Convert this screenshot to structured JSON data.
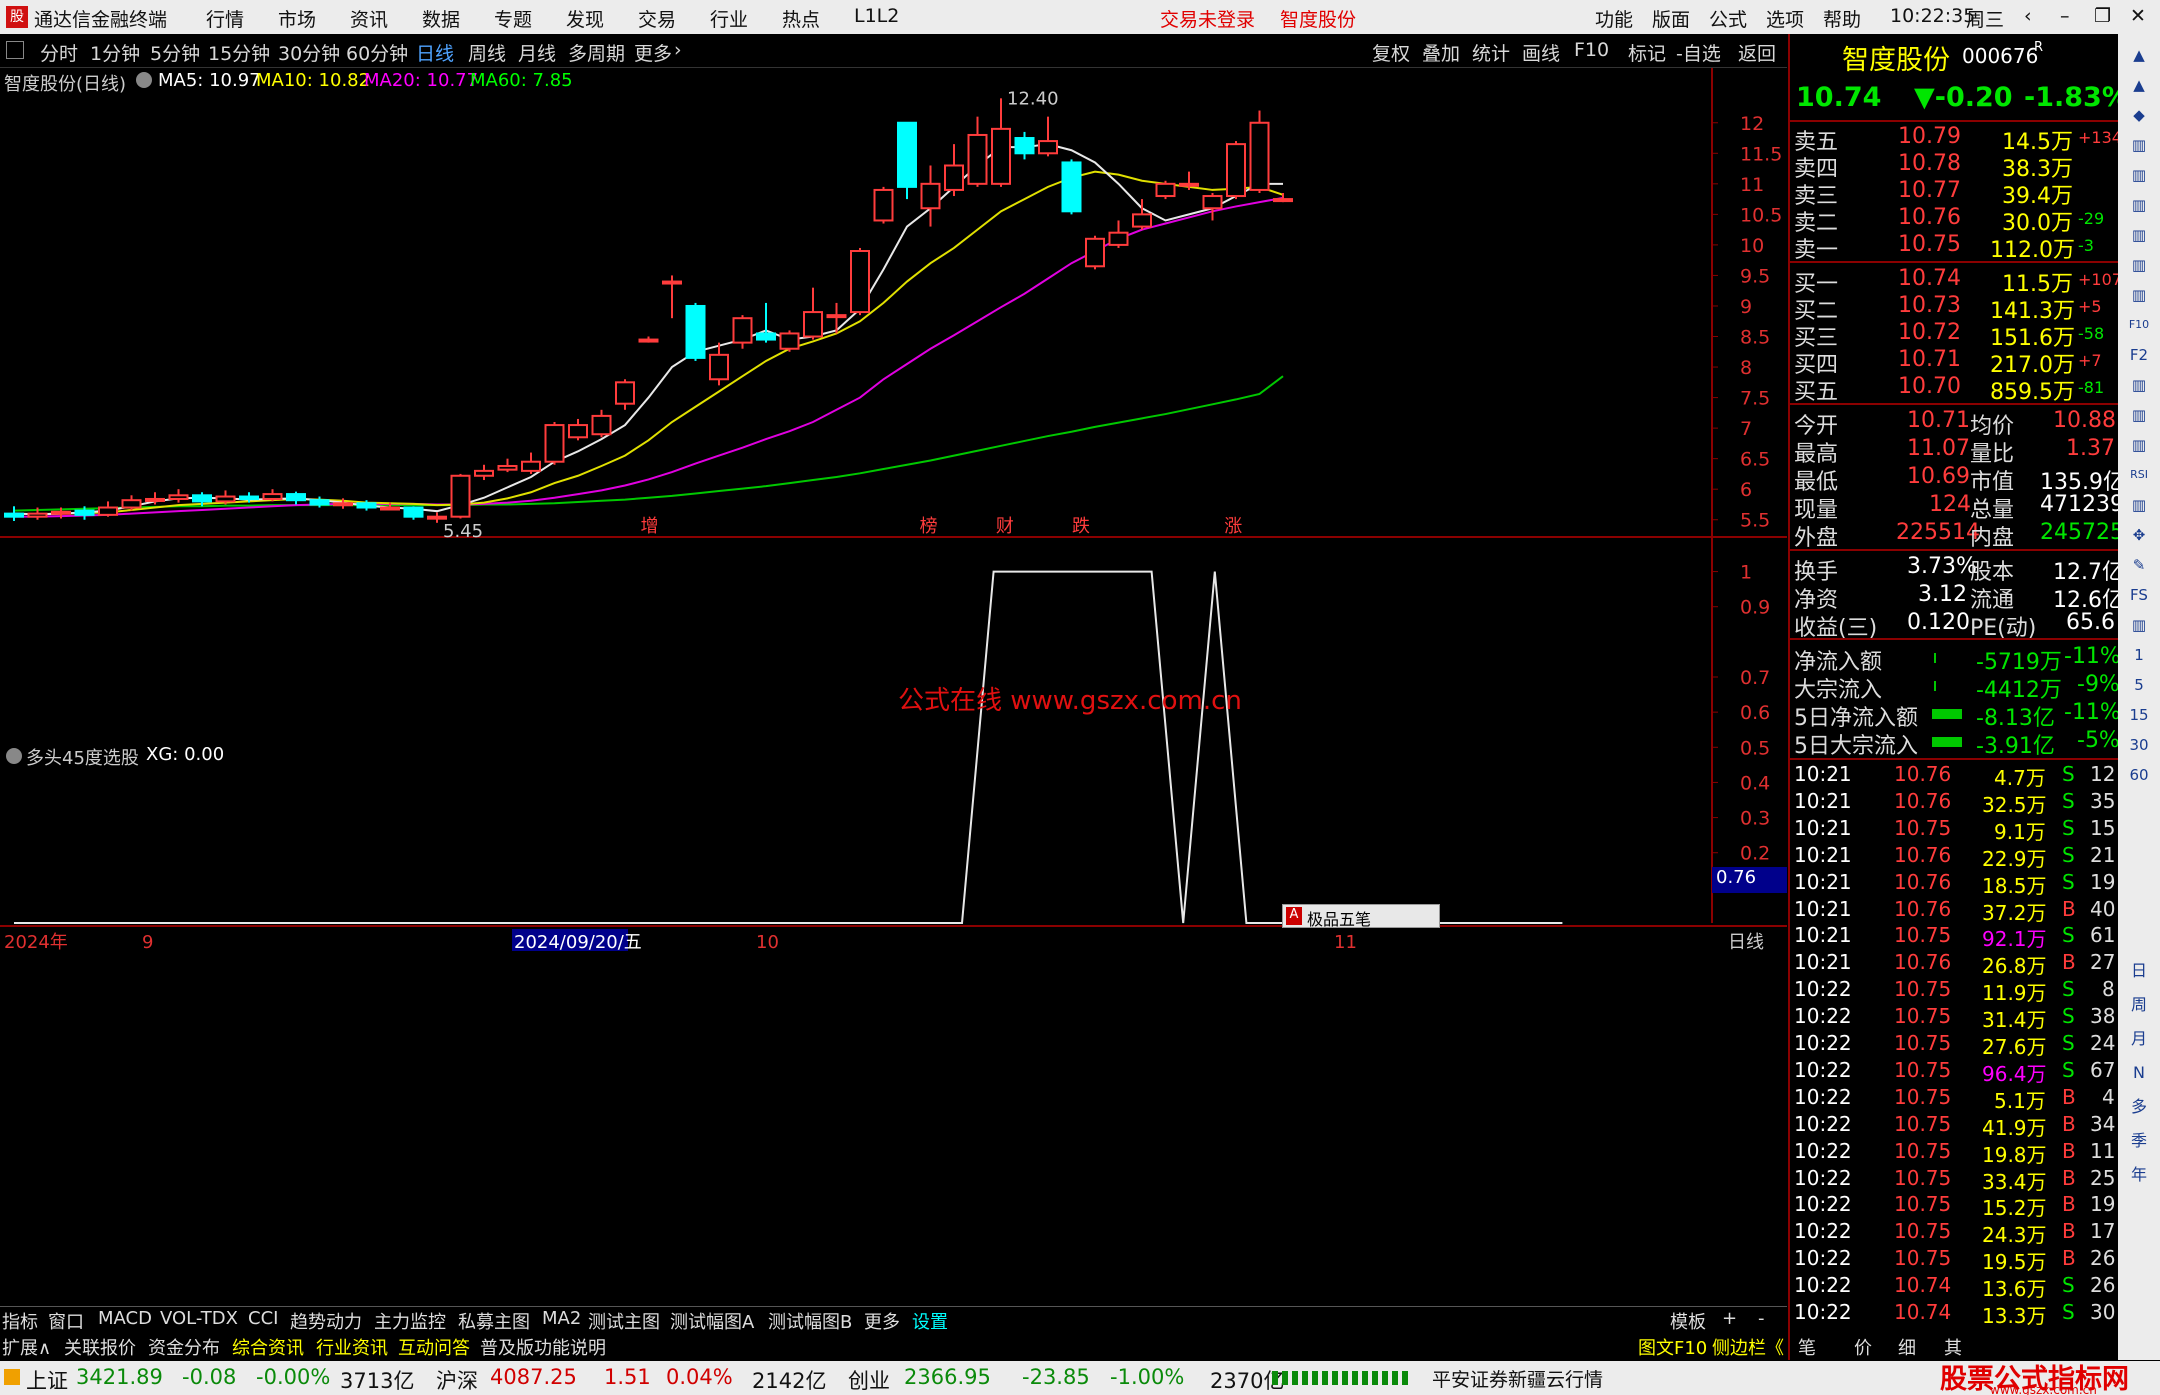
{
  "app": {
    "name": "通达信金融终端",
    "menus": [
      "行情",
      "市场",
      "资讯",
      "数据",
      "专题",
      "发现",
      "交易",
      "行业",
      "热点",
      "L1L2"
    ],
    "login_status": "交易未登录",
    "stock_title": "智度股份",
    "right_menus": [
      "功能",
      "版面",
      "公式",
      "选项",
      "帮助"
    ],
    "time": "10:22:35",
    "weekday": "周三"
  },
  "toolbar": {
    "periods": [
      "分时",
      "1分钟",
      "5分钟",
      "15分钟",
      "30分钟",
      "60分钟",
      "日线",
      "周线",
      "月线",
      "多周期",
      "更多"
    ],
    "active": "日线",
    "right_buttons": [
      "复权",
      "叠加",
      "统计",
      "画线",
      "F10",
      "标记",
      "-自选",
      "返回"
    ]
  },
  "main_chart": {
    "label": "智度股份(日线)",
    "ma": [
      {
        "label": "MA5: 10.97",
        "color": "#ffffff"
      },
      {
        "label": "MA10: 10.82",
        "color": "#ffff00"
      },
      {
        "label": "MA20: 10.77",
        "color": "#ff00ff"
      },
      {
        "label": "MA60: 7.85",
        "color": "#00ff00"
      }
    ],
    "high_label": "12.40",
    "low_label": "5.45",
    "watermark": "公式在线 www.gszx.com.cn",
    "events": [
      "增",
      "榜",
      "财",
      "跌",
      "涨"
    ]
  },
  "chart_data": [
    {
      "type": "candlestick",
      "yticks": [
        12.0,
        11.5,
        11.0,
        10.5,
        10.0,
        9.5,
        9.0,
        8.5,
        8.0,
        7.5,
        7.0,
        6.5,
        6.0,
        5.5
      ],
      "ylim": [
        5.25,
        12.7
      ],
      "candles": [
        [
          5.6,
          5.55,
          5.72,
          5.48
        ],
        [
          5.55,
          5.6,
          5.7,
          5.5
        ],
        [
          5.6,
          5.63,
          5.7,
          5.52
        ],
        [
          5.65,
          5.58,
          5.72,
          5.5
        ],
        [
          5.58,
          5.7,
          5.8,
          5.55
        ],
        [
          5.7,
          5.82,
          5.9,
          5.65
        ],
        [
          5.82,
          5.84,
          5.95,
          5.75
        ],
        [
          5.84,
          5.9,
          6.0,
          5.78
        ],
        [
          5.9,
          5.8,
          5.95,
          5.72
        ],
        [
          5.8,
          5.88,
          5.98,
          5.75
        ],
        [
          5.88,
          5.84,
          5.95,
          5.78
        ],
        [
          5.84,
          5.92,
          6.0,
          5.8
        ],
        [
          5.92,
          5.82,
          5.96,
          5.75
        ],
        [
          5.82,
          5.75,
          5.88,
          5.7
        ],
        [
          5.75,
          5.77,
          5.85,
          5.68
        ],
        [
          5.77,
          5.7,
          5.82,
          5.65
        ],
        [
          5.7,
          5.7,
          5.78,
          5.66
        ],
        [
          5.7,
          5.55,
          5.72,
          5.5
        ],
        [
          5.55,
          5.55,
          5.62,
          5.45
        ],
        [
          5.55,
          6.22,
          6.25,
          5.52
        ],
        [
          6.22,
          6.3,
          6.4,
          6.15
        ],
        [
          6.32,
          6.38,
          6.5,
          6.28
        ],
        [
          6.3,
          6.45,
          6.6,
          6.25
        ],
        [
          6.45,
          7.05,
          7.1,
          6.4
        ],
        [
          6.85,
          7.05,
          7.15,
          6.8
        ],
        [
          6.9,
          7.2,
          7.3,
          6.85
        ],
        [
          7.4,
          7.75,
          7.8,
          7.3
        ],
        [
          8.45,
          8.45,
          8.5,
          8.4
        ],
        [
          9.4,
          9.4,
          9.5,
          8.8
        ],
        [
          9.0,
          8.15,
          9.05,
          8.1
        ],
        [
          7.8,
          8.2,
          8.4,
          7.7
        ],
        [
          8.4,
          8.8,
          8.85,
          8.3
        ],
        [
          8.55,
          8.45,
          9.05,
          8.4
        ],
        [
          8.3,
          8.55,
          8.6,
          8.25
        ],
        [
          8.5,
          8.9,
          9.3,
          8.45
        ],
        [
          8.85,
          8.85,
          9.05,
          8.55
        ],
        [
          8.9,
          9.9,
          9.95,
          8.85
        ],
        [
          10.4,
          10.9,
          10.95,
          10.35
        ],
        [
          12.0,
          10.95,
          12.0,
          10.75
        ],
        [
          10.6,
          11.0,
          11.3,
          10.3
        ],
        [
          10.9,
          11.3,
          11.65,
          10.8
        ],
        [
          11.0,
          11.8,
          12.1,
          10.95
        ],
        [
          11.0,
          11.9,
          12.4,
          10.95
        ],
        [
          11.75,
          11.5,
          11.85,
          11.4
        ],
        [
          11.5,
          11.7,
          12.1,
          11.45
        ],
        [
          11.35,
          10.55,
          11.4,
          10.5
        ],
        [
          9.65,
          10.1,
          10.15,
          9.6
        ],
        [
          10.0,
          10.2,
          10.4,
          9.95
        ],
        [
          10.3,
          10.5,
          10.75,
          10.25
        ],
        [
          10.8,
          11.0,
          11.05,
          10.75
        ],
        [
          11.0,
          11.0,
          11.2,
          10.9
        ],
        [
          10.6,
          10.8,
          10.85,
          10.4
        ],
        [
          10.8,
          11.65,
          11.7,
          10.75
        ],
        [
          10.9,
          12.0,
          12.2,
          10.85
        ],
        [
          10.75,
          10.75,
          10.85,
          10.7
        ]
      ],
      "ma5": [
        5.6,
        5.59,
        5.6,
        5.62,
        5.65,
        5.72,
        5.8,
        5.85,
        5.86,
        5.85,
        5.83,
        5.84,
        5.85,
        5.82,
        5.78,
        5.73,
        5.7,
        5.68,
        5.64,
        5.74,
        5.86,
        6.03,
        6.2,
        6.45,
        6.62,
        6.82,
        7.05,
        7.5,
        8.0,
        8.25,
        8.35,
        8.45,
        8.6,
        8.45,
        8.5,
        8.6,
        8.95,
        9.6,
        10.3,
        10.6,
        10.95,
        11.3,
        11.6,
        11.6,
        11.65,
        11.55,
        11.35,
        11.0,
        10.6,
        10.4,
        10.5,
        10.6,
        10.8,
        11.0,
        11.0
      ],
      "ma10": [
        5.6,
        5.59,
        5.6,
        5.61,
        5.62,
        5.66,
        5.7,
        5.74,
        5.76,
        5.78,
        5.8,
        5.82,
        5.84,
        5.83,
        5.81,
        5.78,
        5.77,
        5.76,
        5.74,
        5.75,
        5.78,
        5.85,
        5.95,
        6.1,
        6.22,
        6.38,
        6.55,
        6.8,
        7.1,
        7.35,
        7.6,
        7.85,
        8.1,
        8.3,
        8.42,
        8.55,
        8.75,
        9.05,
        9.4,
        9.7,
        9.95,
        10.25,
        10.55,
        10.75,
        10.95,
        11.1,
        11.2,
        11.15,
        11.05,
        11.0,
        10.95,
        10.9,
        10.92,
        10.95,
        10.82
      ],
      "ma20": [
        5.55,
        5.55,
        5.56,
        5.57,
        5.58,
        5.6,
        5.62,
        5.64,
        5.66,
        5.68,
        5.7,
        5.72,
        5.74,
        5.75,
        5.76,
        5.76,
        5.76,
        5.76,
        5.75,
        5.75,
        5.76,
        5.78,
        5.81,
        5.86,
        5.92,
        5.98,
        6.06,
        6.16,
        6.28,
        6.42,
        6.55,
        6.68,
        6.82,
        6.95,
        7.1,
        7.3,
        7.5,
        7.8,
        8.05,
        8.3,
        8.52,
        8.75,
        8.98,
        9.2,
        9.45,
        9.7,
        9.9,
        10.1,
        10.25,
        10.35,
        10.45,
        10.55,
        10.63,
        10.7,
        10.77
      ],
      "ma60": [
        5.65,
        5.66,
        5.67,
        5.68,
        5.69,
        5.7,
        5.71,
        5.72,
        5.72,
        5.73,
        5.73,
        5.74,
        5.74,
        5.74,
        5.74,
        5.74,
        5.74,
        5.74,
        5.74,
        5.74,
        5.75,
        5.75,
        5.76,
        5.77,
        5.79,
        5.81,
        5.83,
        5.86,
        5.89,
        5.93,
        5.97,
        6.01,
        6.05,
        6.1,
        6.15,
        6.2,
        6.26,
        6.33,
        6.4,
        6.47,
        6.55,
        6.63,
        6.71,
        6.79,
        6.87,
        6.94,
        7.02,
        7.09,
        7.16,
        7.23,
        7.31,
        7.39,
        7.47,
        7.56,
        7.85
      ]
    },
    {
      "type": "line",
      "label": "多头45度选股",
      "value_label": "XG: 0.00",
      "yticks": [
        1.0,
        0.9,
        0.7,
        0.6,
        0.5,
        0.4,
        0.3,
        0.2
      ],
      "ylim": [
        0,
        1.05
      ],
      "values": [
        0,
        0,
        0,
        0,
        0,
        0,
        0,
        0,
        0,
        0,
        0,
        0,
        0,
        0,
        0,
        0,
        0,
        0,
        0,
        0,
        0,
        0,
        0,
        0,
        0,
        0,
        0,
        0,
        0,
        0,
        0,
        1,
        1,
        1,
        1,
        1,
        1,
        0,
        1,
        0,
        0,
        0,
        0,
        0,
        0,
        0,
        0,
        0,
        0,
        0
      ],
      "cursor_label": "0.76"
    }
  ],
  "x_axis": [
    "2024年",
    "9",
    "2024/09/20/五",
    "10",
    "11"
  ],
  "x_axis_right": "日线",
  "ime_label": "极品五笔",
  "quote": {
    "name": "智度股份",
    "code": "000676",
    "flag": "R",
    "price": "10.74",
    "change": "▼-0.20",
    "pct": "-1.83%",
    "asks": [
      {
        "label": "卖五",
        "price": "10.79",
        "vol": "14.5万",
        "chg": "+134"
      },
      {
        "label": "卖四",
        "price": "10.78",
        "vol": "38.3万",
        "chg": ""
      },
      {
        "label": "卖三",
        "price": "10.77",
        "vol": "39.4万",
        "chg": ""
      },
      {
        "label": "卖二",
        "price": "10.76",
        "vol": "30.0万",
        "chg": "-29"
      },
      {
        "label": "卖一",
        "price": "10.75",
        "vol": "112.0万",
        "chg": "-3"
      }
    ],
    "bids": [
      {
        "label": "买一",
        "price": "10.74",
        "vol": "11.5万",
        "chg": "+107"
      },
      {
        "label": "买二",
        "price": "10.73",
        "vol": "141.3万",
        "chg": "+5"
      },
      {
        "label": "买三",
        "price": "10.72",
        "vol": "151.6万",
        "chg": "-58"
      },
      {
        "label": "买四",
        "price": "10.71",
        "vol": "217.0万",
        "chg": "+7"
      },
      {
        "label": "买五",
        "price": "10.70",
        "vol": "859.5万",
        "chg": "-81"
      }
    ],
    "stats": [
      [
        "今开",
        "10.71",
        "均价",
        "10.88"
      ],
      [
        "最高",
        "11.07",
        "量比",
        "1.37"
      ],
      [
        "最低",
        "10.69",
        "市值",
        "135.9亿"
      ],
      [
        "现量",
        "124",
        "总量",
        "471239"
      ],
      [
        "外盘",
        "225514",
        "内盘",
        "245725"
      ],
      [
        "换手",
        "3.73%",
        "股本",
        "12.7亿"
      ],
      [
        "净资",
        "3.12",
        "流通",
        "12.6亿"
      ],
      [
        "收益(三)",
        "0.120",
        "PE(动)",
        "65.6"
      ]
    ],
    "flows": [
      [
        "净流入额",
        "-5719万",
        "-11%"
      ],
      [
        "大宗流入",
        "-4412万",
        "-9%"
      ],
      [
        "5日净流入额",
        "-8.13亿",
        "-11%"
      ],
      [
        "5日大宗流入",
        "-3.91亿",
        "-5%"
      ]
    ]
  },
  "ticks": [
    [
      "10:21",
      "10.76",
      "4.7万",
      "S",
      "12"
    ],
    [
      "10:21",
      "10.76",
      "32.5万",
      "S",
      "35"
    ],
    [
      "10:21",
      "10.75",
      "9.1万",
      "S",
      "15"
    ],
    [
      "10:21",
      "10.76",
      "22.9万",
      "S",
      "21"
    ],
    [
      "10:21",
      "10.76",
      "18.5万",
      "S",
      "19"
    ],
    [
      "10:21",
      "10.76",
      "37.2万",
      "B",
      "40"
    ],
    [
      "10:21",
      "10.75",
      "92.1万",
      "S",
      "61"
    ],
    [
      "10:21",
      "10.76",
      "26.8万",
      "B",
      "27"
    ],
    [
      "10:22",
      "10.75",
      "11.9万",
      "S",
      "8"
    ],
    [
      "10:22",
      "10.75",
      "31.4万",
      "S",
      "38"
    ],
    [
      "10:22",
      "10.75",
      "27.6万",
      "S",
      "24"
    ],
    [
      "10:22",
      "10.75",
      "96.4万",
      "S",
      "67"
    ],
    [
      "10:22",
      "10.75",
      "5.1万",
      "B",
      "4"
    ],
    [
      "10:22",
      "10.75",
      "41.9万",
      "B",
      "34"
    ],
    [
      "10:22",
      "10.75",
      "19.8万",
      "B",
      "11"
    ],
    [
      "10:22",
      "10.75",
      "33.4万",
      "B",
      "25"
    ],
    [
      "10:22",
      "10.75",
      "15.2万",
      "B",
      "19"
    ],
    [
      "10:22",
      "10.75",
      "24.3万",
      "B",
      "17"
    ],
    [
      "10:22",
      "10.75",
      "19.5万",
      "B",
      "26"
    ],
    [
      "10:22",
      "10.74",
      "13.6万",
      "S",
      "26"
    ],
    [
      "10:22",
      "10.74",
      "13.3万",
      "S",
      "30"
    ]
  ],
  "bottom_tabs": [
    "指标",
    "窗口",
    "MACD",
    "VOL-TDX",
    "CCI",
    "趋势动力",
    "主力监控",
    "私募主图",
    "MA2",
    "测试主图",
    "测试幅图A",
    "测试幅图B",
    "更多",
    "设置"
  ],
  "bottom_right": [
    "模板",
    "+",
    "-"
  ],
  "info_tabs": [
    "扩展∧",
    "关联报价",
    "资金分布",
    "综合资讯",
    "行业资讯",
    "互动问答",
    "普及版功能说明"
  ],
  "info_right": [
    "图文F10",
    "侧边栏《",
    "笔",
    "价",
    "细",
    "其"
  ],
  "status": {
    "sh": {
      "name": "上证",
      "val": "3421.89",
      "chg": "-0.08",
      "pct": "-0.00%",
      "amt": "3713亿"
    },
    "sz": {
      "name": "沪深",
      "val": "4087.25",
      "chg": "1.51",
      "pct": "0.04%",
      "amt": "2142亿"
    },
    "cy": {
      "name": "创业",
      "val": "2366.95",
      "chg": "-23.85",
      "pct": "-1.00%",
      "amt": "2370亿"
    },
    "broker": "平安证券新疆云行情",
    "logo": "股票公式指标网",
    "logo_url": "www.gszx.com.cn"
  },
  "vtools": [
    "日",
    "周",
    "月",
    "N",
    "多",
    "季",
    "年"
  ],
  "vtools_top": [
    "▲",
    "▲",
    "◆",
    "▥",
    "▥",
    "▥",
    "▥",
    "▥",
    "▥",
    "F10",
    "F2",
    "▥",
    "▥",
    "▥",
    "RSI",
    "▥",
    "✥",
    "✎",
    "FS",
    "▥",
    "1",
    "5",
    "15",
    "30",
    "60"
  ]
}
